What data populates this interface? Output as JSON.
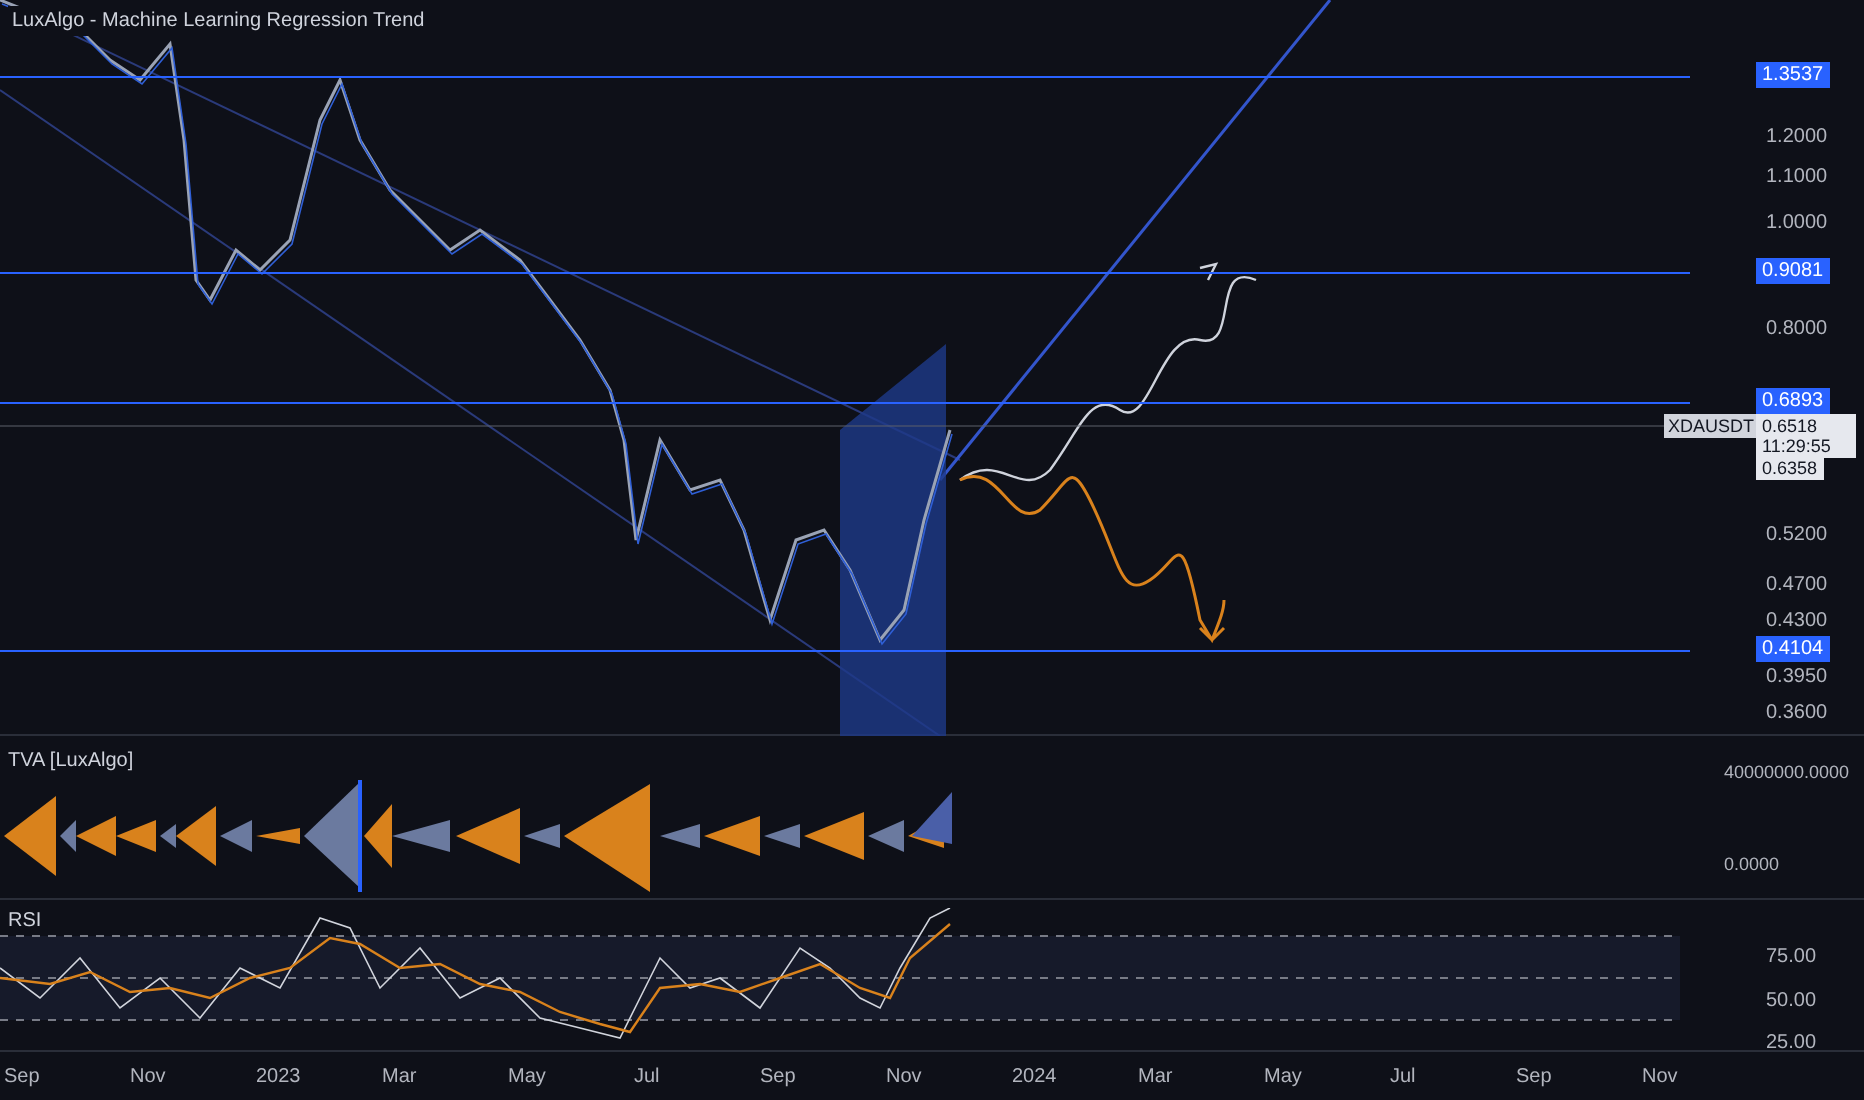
{
  "main_pane": {
    "title": "LuxAlgo - Machine Learning Regression Trend",
    "price_labels": [
      "1.2000",
      "1.1000",
      "1.0000",
      "0.8000",
      "0.5200",
      "0.4700",
      "0.4300",
      "0.3950",
      "0.3600"
    ],
    "levels": [
      "1.3537",
      "0.9081",
      "0.6893",
      "0.4104"
    ],
    "symbol_tag": "XDAUSDT",
    "last_price": "0.6518",
    "countdown": "11:29:55",
    "prev_close": "0.6358"
  },
  "tva_pane": {
    "title": "TVA [LuxAlgo]",
    "axis_labels": [
      "40000000.0000",
      "0.0000"
    ]
  },
  "rsi_pane": {
    "title": "RSI",
    "axis_labels": [
      "75.00",
      "50.00",
      "25.00"
    ]
  },
  "time_axis": [
    "Sep",
    "Nov",
    "2023",
    "Mar",
    "May",
    "Jul",
    "Sep",
    "Nov",
    "2024",
    "Mar",
    "May",
    "Jul",
    "Sep",
    "Nov"
  ]
}
